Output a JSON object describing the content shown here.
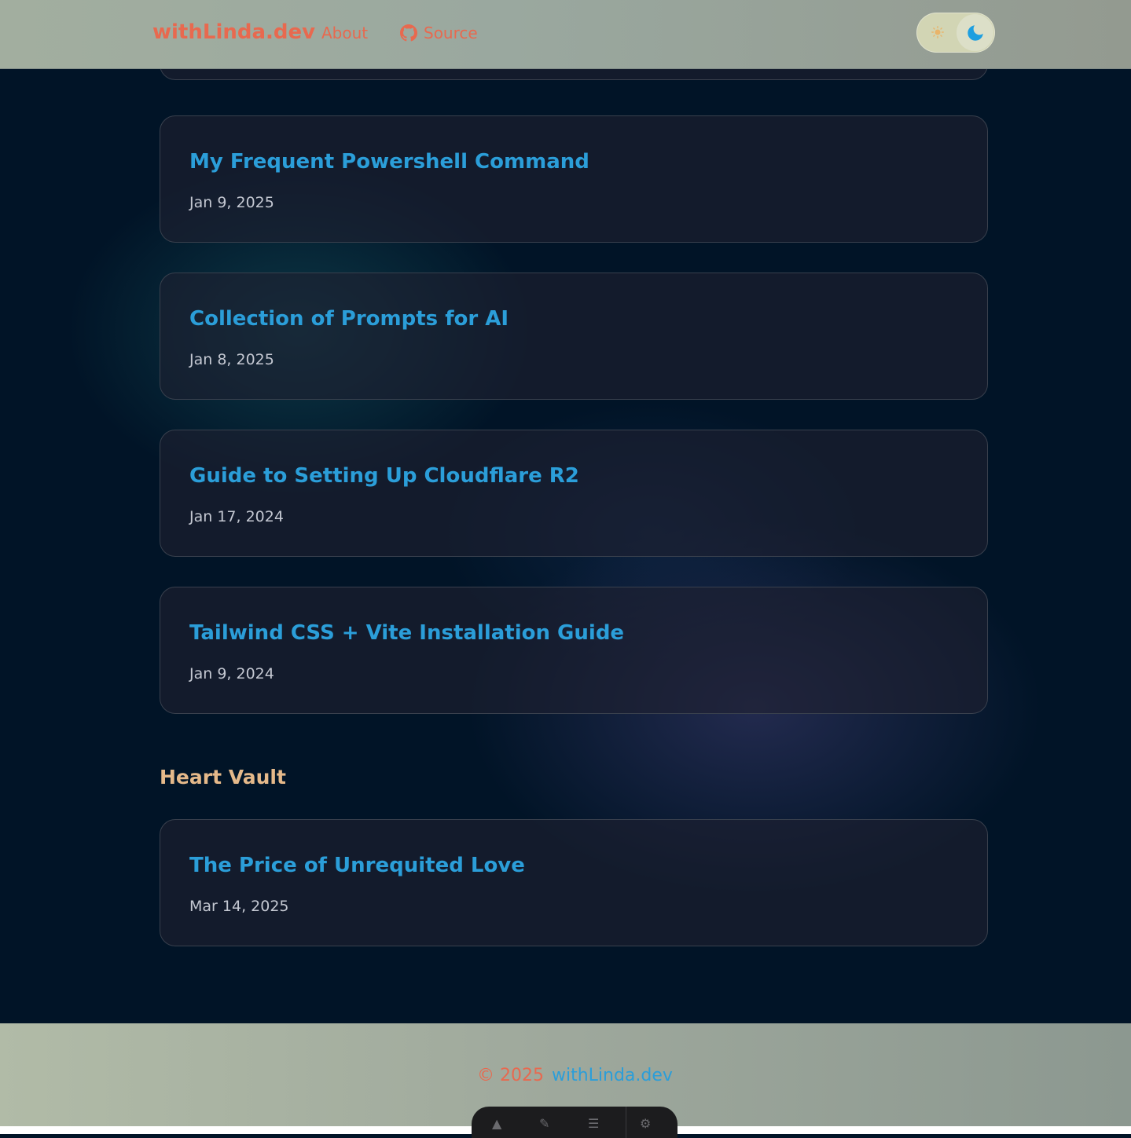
{
  "header": {
    "brand": "withLinda.dev",
    "nav": {
      "about": "About",
      "source": "Source"
    },
    "theme_toggle": {
      "sun_icon": "sun-icon",
      "moon_icon": "moon-icon",
      "active": "dark"
    }
  },
  "posts": [
    {
      "title": "My Frequent Powershell Command",
      "date": "Jan 9, 2025"
    },
    {
      "title": "Collection of Prompts for AI",
      "date": "Jan 8, 2025"
    },
    {
      "title": "Guide to Setting Up Cloudflare R2",
      "date": "Jan 17, 2024"
    },
    {
      "title": "Tailwind CSS + Vite Installation Guide",
      "date": "Jan 9, 2024"
    }
  ],
  "heart_vault": {
    "heading": "Heart Vault",
    "posts": [
      {
        "title": "The Price of Unrequited Love",
        "date": "Mar 14, 2025"
      }
    ]
  },
  "footer": {
    "year": "© 2025",
    "brand": "withLinda.dev"
  },
  "colors": {
    "accent": "#2b9ed9",
    "brand": "#e8694f",
    "section_heading": "#e5b98a",
    "background": "#011427"
  }
}
